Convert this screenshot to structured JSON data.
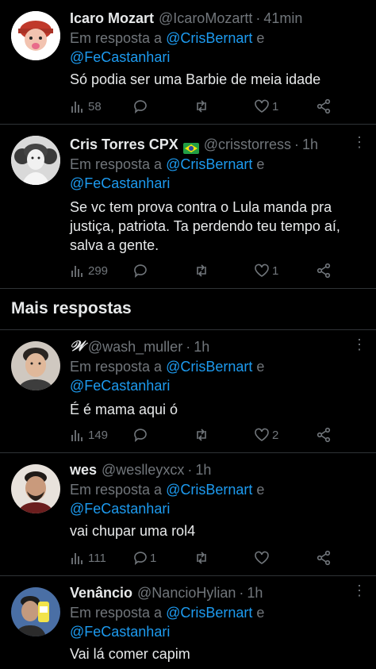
{
  "colors": {
    "background": "#000000",
    "accent": "#1d9bf0",
    "muted": "#71767b",
    "text": "#e7e9ea",
    "divider": "#2f3336"
  },
  "reply_prefix": "Em resposta a",
  "reply_conj": "e",
  "mention_1": "@CrisBernart",
  "mention_2": "@FeCastanhari",
  "section_title": "Mais respostas",
  "tweets": [
    {
      "name": "Icaro Mozart",
      "handle": "@IcaroMozartt",
      "time": "41min",
      "text": "Só podia ser uma Barbie de meia idade",
      "views": "58",
      "replies": "",
      "retweets": "",
      "likes": "1"
    },
    {
      "name": "Cris Torres CPX",
      "flag": "brazil-flag-icon",
      "handle": "@crisstorress",
      "time": "1h",
      "text": "Se vc tem prova contra o Lula manda pra justiça, patriota. Ta perdendo teu tempo aí, salva a gente.",
      "views": "299",
      "replies": "",
      "retweets": "",
      "likes": "1"
    },
    {
      "name": "𝒲",
      "handle": "@wash_muller",
      "time": "1h",
      "text": "É é mama aqui ó",
      "views": "149",
      "replies": "",
      "retweets": "",
      "likes": "2"
    },
    {
      "name": "wes",
      "handle": "@weslleyxcx",
      "time": "1h",
      "text": "vai chupar uma rol4",
      "views": "111",
      "replies": "1",
      "retweets": "",
      "likes": ""
    },
    {
      "name": "Venâncio",
      "handle": "@NancioHylian",
      "time": "1h",
      "text": "Vai lá comer capim"
    }
  ]
}
